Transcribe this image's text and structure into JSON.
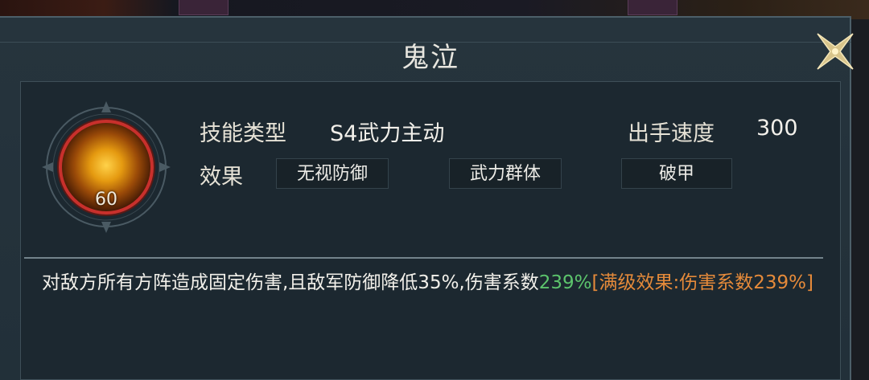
{
  "dialog": {
    "title": "鬼泣",
    "close_icon": "close-x-icon"
  },
  "skill": {
    "icon": "flame-beast-icon",
    "level": "60",
    "type_label": "技能类型",
    "type_value": "S4武力主动",
    "speed_label": "出手速度",
    "speed_value": "300",
    "effect_label": "效果",
    "effects": [
      "无视防御",
      "武力群体",
      "破甲"
    ]
  },
  "description": {
    "main": "对敌方所有方阵造成固定伤害,且敌军防御降低35%,伤害系数",
    "coef": "239%",
    "max_level": "[满级效果:伤害系数239%]"
  },
  "colors": {
    "panel_bg": "#26343d",
    "coef_green": "#5cc46c",
    "max_orange": "#e58a3a",
    "icon_border": "#c8302c"
  }
}
